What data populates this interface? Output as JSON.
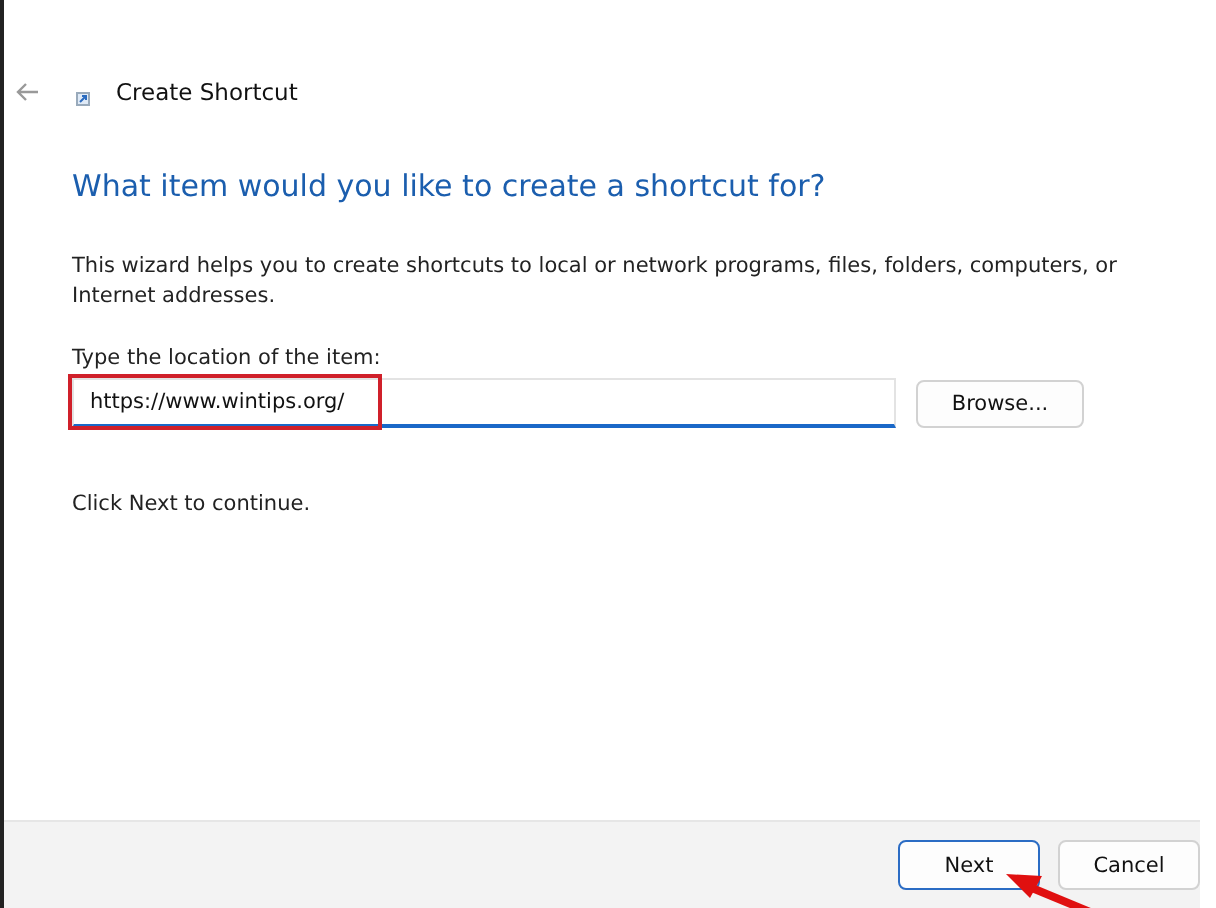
{
  "window": {
    "title": "Create Shortcut"
  },
  "heading": "What item would you like to create a shortcut for?",
  "description": "This wizard helps you to create shortcuts to local or network programs, files, folders, computers, or Internet addresses.",
  "location": {
    "label": "Type the location of the item:",
    "value": "https://www.wintips.org/"
  },
  "browse_button": "Browse...",
  "hint": "Click Next to continue.",
  "buttons": [
    {
      "label": "Next",
      "kind": "default"
    },
    {
      "label": "Cancel",
      "kind": "normal"
    }
  ]
}
